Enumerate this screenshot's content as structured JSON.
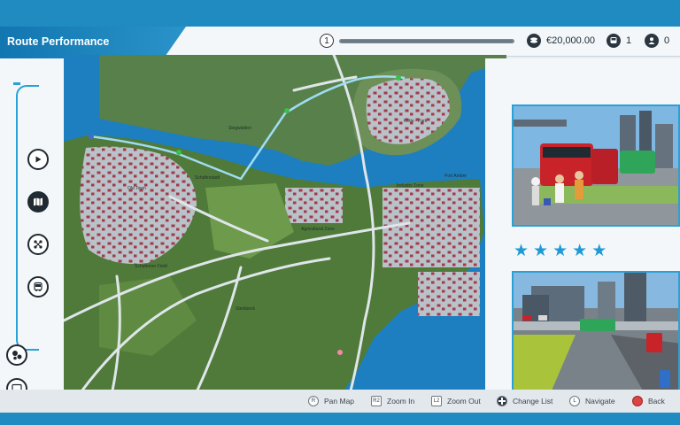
{
  "header": {
    "title": "Route Performance",
    "route_number": "1",
    "route_progress": 1.0,
    "money": "€20,000.00",
    "buses": "1",
    "drivers": "0",
    "icons": [
      "coins-icon",
      "bus-icon",
      "driver-icon"
    ]
  },
  "sidebar": {
    "items": [
      {
        "name": "play-icon",
        "active": false
      },
      {
        "name": "map-icon",
        "active": true
      },
      {
        "name": "route-icon",
        "active": false
      },
      {
        "name": "bus-icon",
        "active": false
      },
      {
        "name": "settings-icon",
        "active": false
      },
      {
        "name": "monitor-icon",
        "active": false
      }
    ]
  },
  "map": {
    "labels": {
      "siegwalden": "Siegwalden",
      "kette_park": "Kette - Park",
      "schaferstadt": "Schäferstadt",
      "industry_zone": "Industry Zone",
      "port_amber": "Port Amber",
      "old_town": "Old Town",
      "agricultural_zone": "Agricultural Zone",
      "schaferner_field": "Schaferner Field",
      "steinbeck": "Steinbeck"
    }
  },
  "rating": {
    "stars": 5
  },
  "controls": [
    {
      "key": "R",
      "label": "Pan Map"
    },
    {
      "key": "R2",
      "label": "Zoom In"
    },
    {
      "key": "L2",
      "label": "Zoom Out"
    },
    {
      "key": "",
      "label": "Change List"
    },
    {
      "key": "L",
      "label": "Navigate"
    },
    {
      "key": "",
      "label": "Back"
    }
  ],
  "colors": {
    "accent": "#2aa1d6",
    "water": "#1d7fc0",
    "land": "#4f7a3a",
    "bus": "#c9232a"
  }
}
